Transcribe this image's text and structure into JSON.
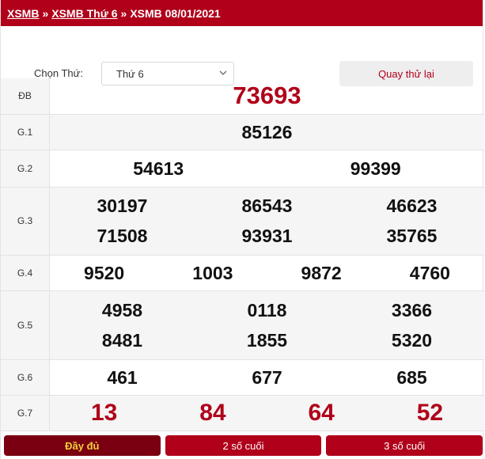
{
  "breadcrumb": {
    "items": [
      "XSMB",
      "XSMB Thứ 6",
      "XSMB 08/01/2021"
    ],
    "separator": "»"
  },
  "controls": {
    "day_label": "Chọn Thứ:",
    "day_value": "Thứ 6",
    "back_button": "Quay thử lại"
  },
  "results": [
    {
      "label": "ĐB",
      "numbers": [
        "73693"
      ]
    },
    {
      "label": "G.1",
      "numbers": [
        "85126"
      ]
    },
    {
      "label": "G.2",
      "numbers": [
        "54613",
        "99399"
      ]
    },
    {
      "label": "G.3",
      "numbers": [
        "30197",
        "86543",
        "46623",
        "71508",
        "93931",
        "35765"
      ]
    },
    {
      "label": "G.4",
      "numbers": [
        "9520",
        "1003",
        "9872",
        "4760"
      ]
    },
    {
      "label": "G.5",
      "numbers": [
        "4958",
        "0118",
        "3366",
        "8481",
        "1855",
        "5320"
      ]
    },
    {
      "label": "G.6",
      "numbers": [
        "461",
        "677",
        "685"
      ]
    },
    {
      "label": "G.7",
      "numbers": [
        "13",
        "84",
        "64",
        "52"
      ]
    }
  ],
  "footer": {
    "buttons": [
      "Đầy đủ",
      "2 số cuối",
      "3 số cuối"
    ],
    "active_index": 0
  },
  "colors": {
    "brand_red": "#b0001a",
    "active_button": "#7a0011",
    "active_text": "#f2d13a"
  }
}
